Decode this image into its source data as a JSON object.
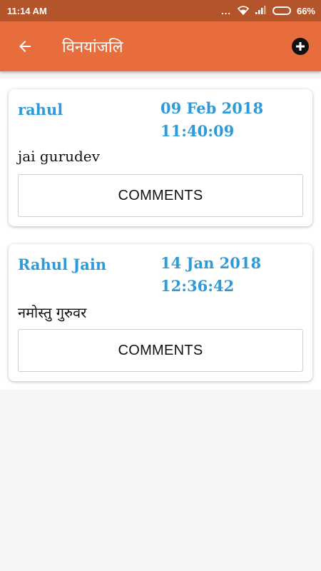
{
  "status_bar": {
    "time": "11:14 AM",
    "dots": "...",
    "battery": "66%",
    "battery_level": 0.66
  },
  "app_bar": {
    "title": "विनयांजलि",
    "back_icon": "arrow-back-icon",
    "add_icon": "add-circle-icon"
  },
  "colors": {
    "status_bar": "#b4542b",
    "app_bar": "#e86d3c",
    "accent_text": "#2f9ad8"
  },
  "posts": [
    {
      "name": "rahul",
      "date": "09 Feb 2018",
      "time": "11:40:09",
      "message": "jai gurudev",
      "button_label": "COMMENTS"
    },
    {
      "name": "Rahul Jain",
      "date": "14 Jan 2018",
      "time": "12:36:42",
      "message": "नमोस्तु गुरुवर",
      "button_label": "COMMENTS"
    }
  ]
}
